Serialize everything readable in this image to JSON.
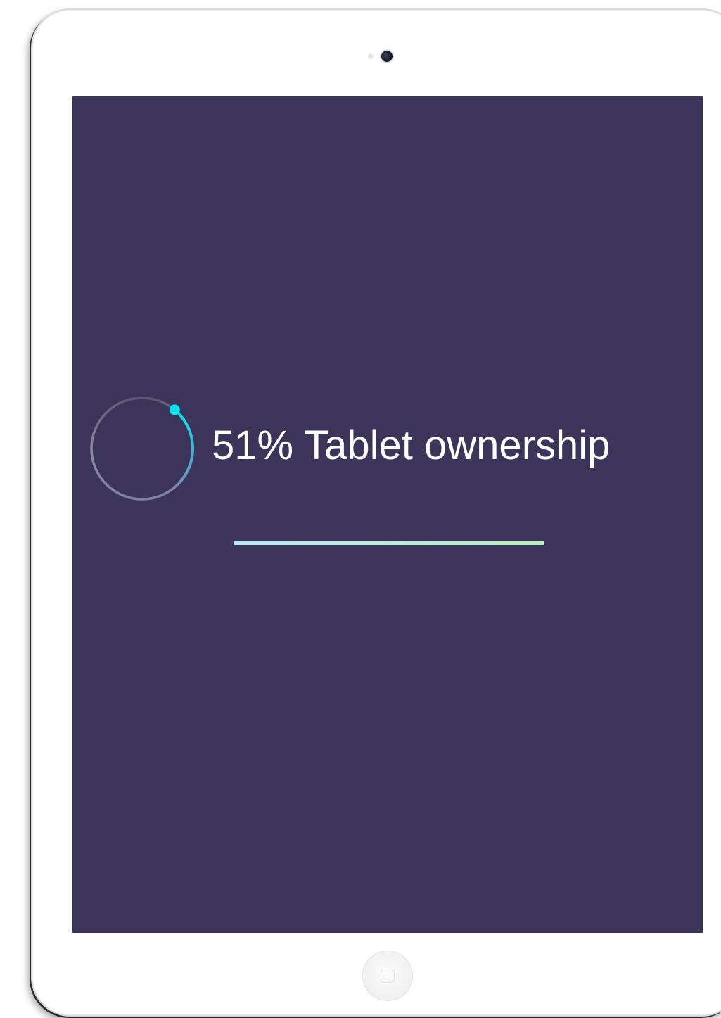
{
  "colors": {
    "screen_background": "#3c3559",
    "ring_active_start": "#00e5ee",
    "ring_active_end": "#6f8fc0",
    "ring_track": "#8d8a9e",
    "heading_text": "#ffffff",
    "divider_start": "#b7e9f4",
    "divider_end": "#b6f0b7"
  },
  "stat": {
    "heading": "51% Tablet ownership",
    "progress_fraction": 0.51
  },
  "icons": {
    "camera": "camera-icon",
    "home": "home-button-icon"
  }
}
